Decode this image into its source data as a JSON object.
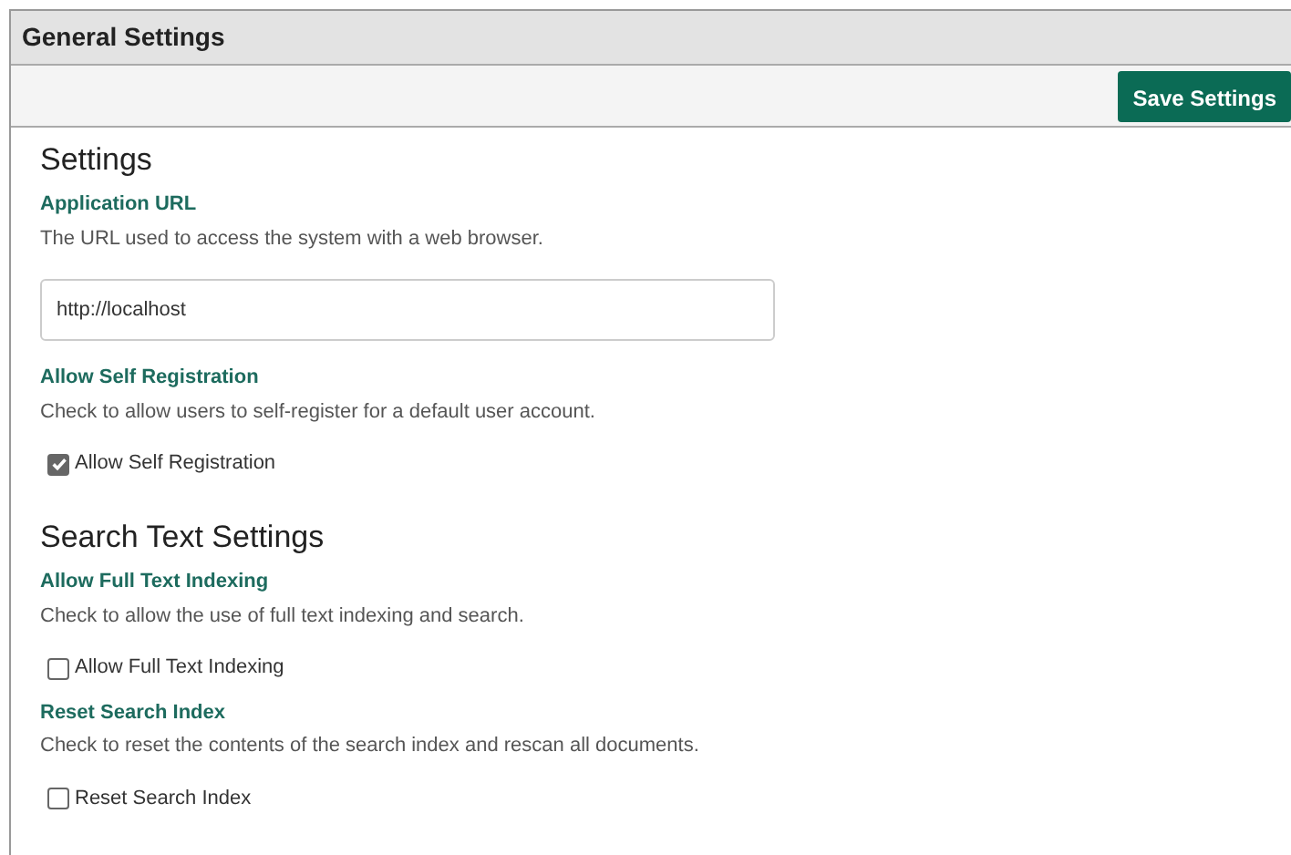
{
  "panel": {
    "title": "General Settings"
  },
  "toolbar": {
    "save_button": "Save Settings"
  },
  "sections": [
    {
      "heading": "Settings",
      "fields": [
        {
          "kind": "text",
          "label": "Application URL",
          "description": "The URL used to access the system with a web browser.",
          "value": "http://localhost"
        },
        {
          "kind": "checkbox",
          "label": "Allow Self Registration",
          "description": "Check to allow users to self-register for a default user account.",
          "option": "Allow Self Registration",
          "checked": true
        }
      ]
    },
    {
      "heading": "Search Text Settings",
      "fields": [
        {
          "kind": "checkbox",
          "label": "Allow Full Text Indexing",
          "description": "Check to allow the use of full text indexing and search.",
          "option": "Allow Full Text Indexing",
          "checked": false
        },
        {
          "kind": "checkbox",
          "label": "Reset Search Index",
          "description": "Check to reset the contents of the search index and rescan all documents.",
          "option": "Reset Search Index",
          "checked": false
        }
      ]
    }
  ]
}
